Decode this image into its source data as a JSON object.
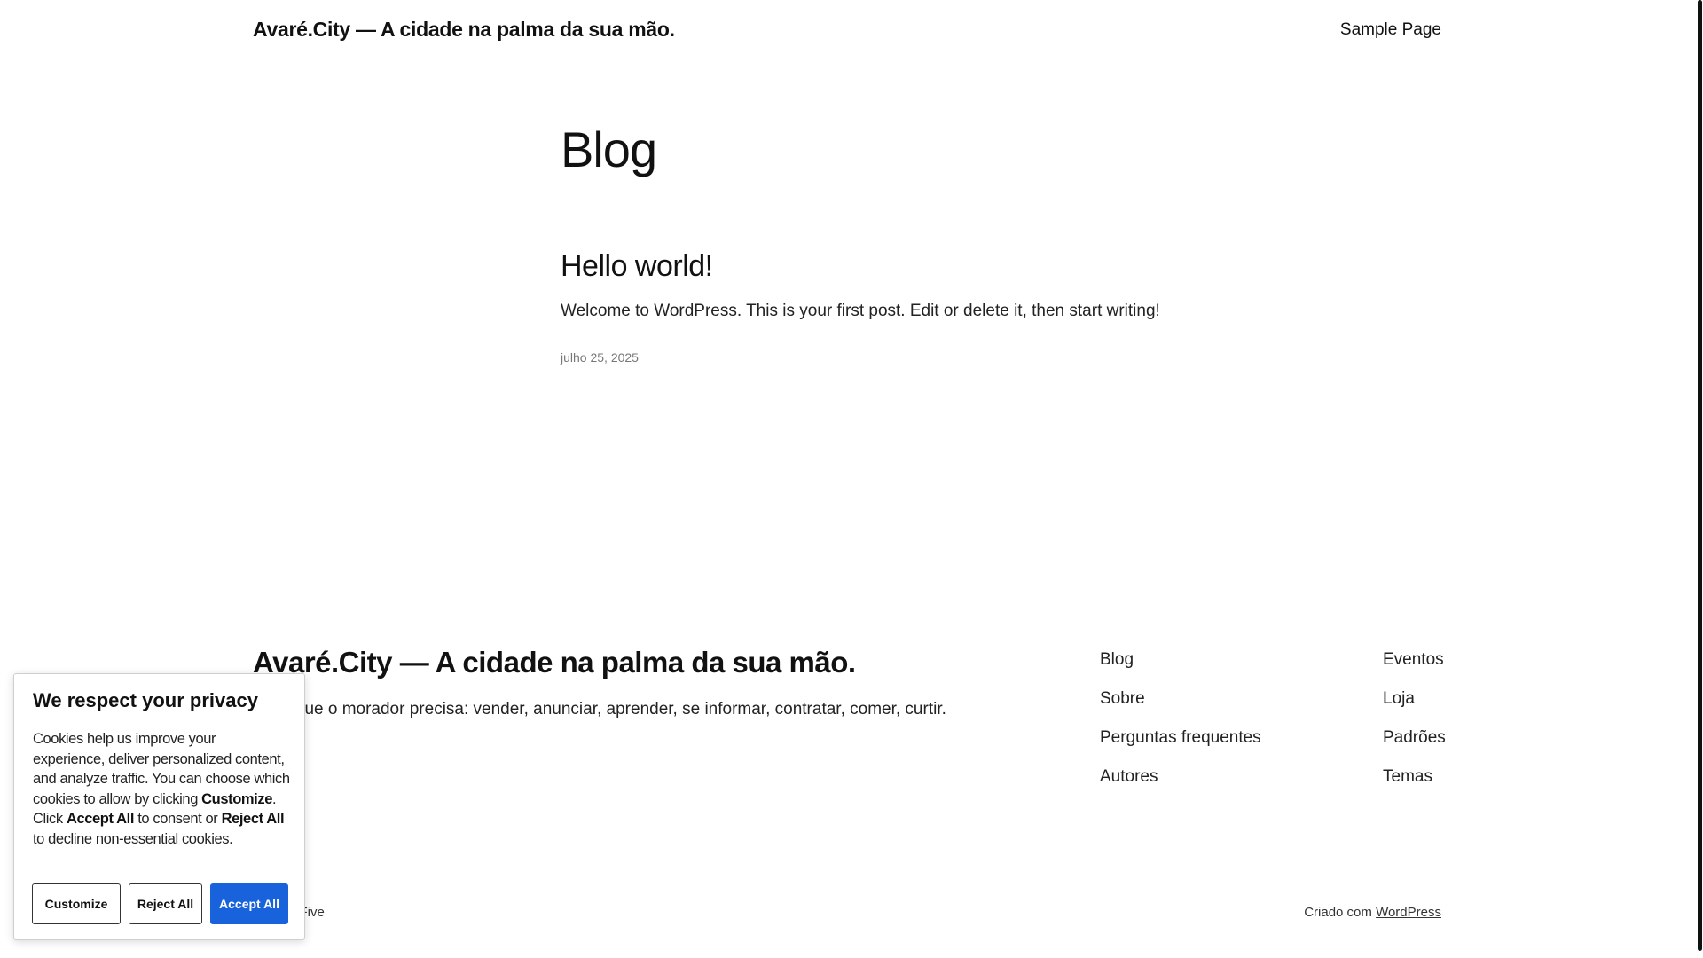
{
  "header": {
    "site_title": "Avaré.City — A cidade na palma da sua mão.",
    "nav_sample_page": "Sample Page"
  },
  "main": {
    "heading": "Blog",
    "posts": [
      {
        "title": "Hello world!",
        "excerpt": "Welcome to WordPress. This is your first post. Edit or delete it, then start writing!",
        "date": "julho 25, 2025"
      }
    ]
  },
  "footer": {
    "title": "Avaré.City — A cidade na palma da sua mão.",
    "tagline": "Tudo que o morador precisa: vender, anunciar, aprender, se informar, contratar, comer, curtir.",
    "links_col1": [
      "Blog",
      "Sobre",
      "Perguntas frequentes",
      "Autores"
    ],
    "links_col2": [
      "Eventos",
      "Loja",
      "Padrões",
      "Temas"
    ],
    "theme_credit": "Twenty-Five",
    "credit_prefix": "Criado com",
    "credit_link": "WordPress"
  },
  "cookie_banner": {
    "title": "We respect your privacy",
    "text_1": "Cookies help us improve your experience, deliver personalized content, and analyze traffic. You can choose which cookies to allow by clicking ",
    "bold_customize": "Customize",
    "text_2": ". Click ",
    "bold_accept": "Accept All",
    "text_3": " to consent or ",
    "bold_reject": "Reject All",
    "text_4": " to decline non-essential cookies.",
    "btn_customize": "Customize",
    "btn_reject": "Reject All",
    "btn_accept": "Accept All",
    "accent_color": "#1863dc"
  }
}
